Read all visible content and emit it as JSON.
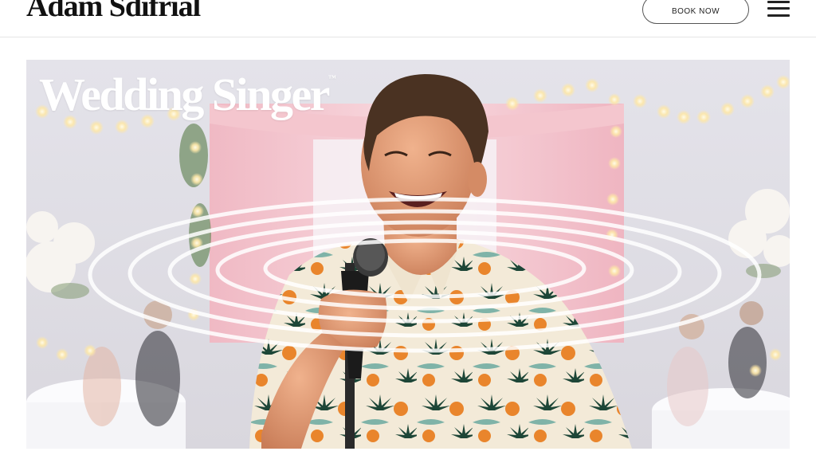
{
  "header": {
    "brand": "Adam Sdifrial",
    "cta_label": "BOOK NOW"
  },
  "hero": {
    "title": "Wedding Singer",
    "title_mark": "™",
    "image_alt": "Smiling singer in a tropical print shirt holding a microphone at a wedding reception with string lights, pink drapes and white flowers"
  },
  "colors": {
    "accent_shirt_orange": "#e8892f",
    "palm_green": "#1f4a3a",
    "drape_pink": "#f3c7cf",
    "light_glow": "#fff3c9"
  }
}
